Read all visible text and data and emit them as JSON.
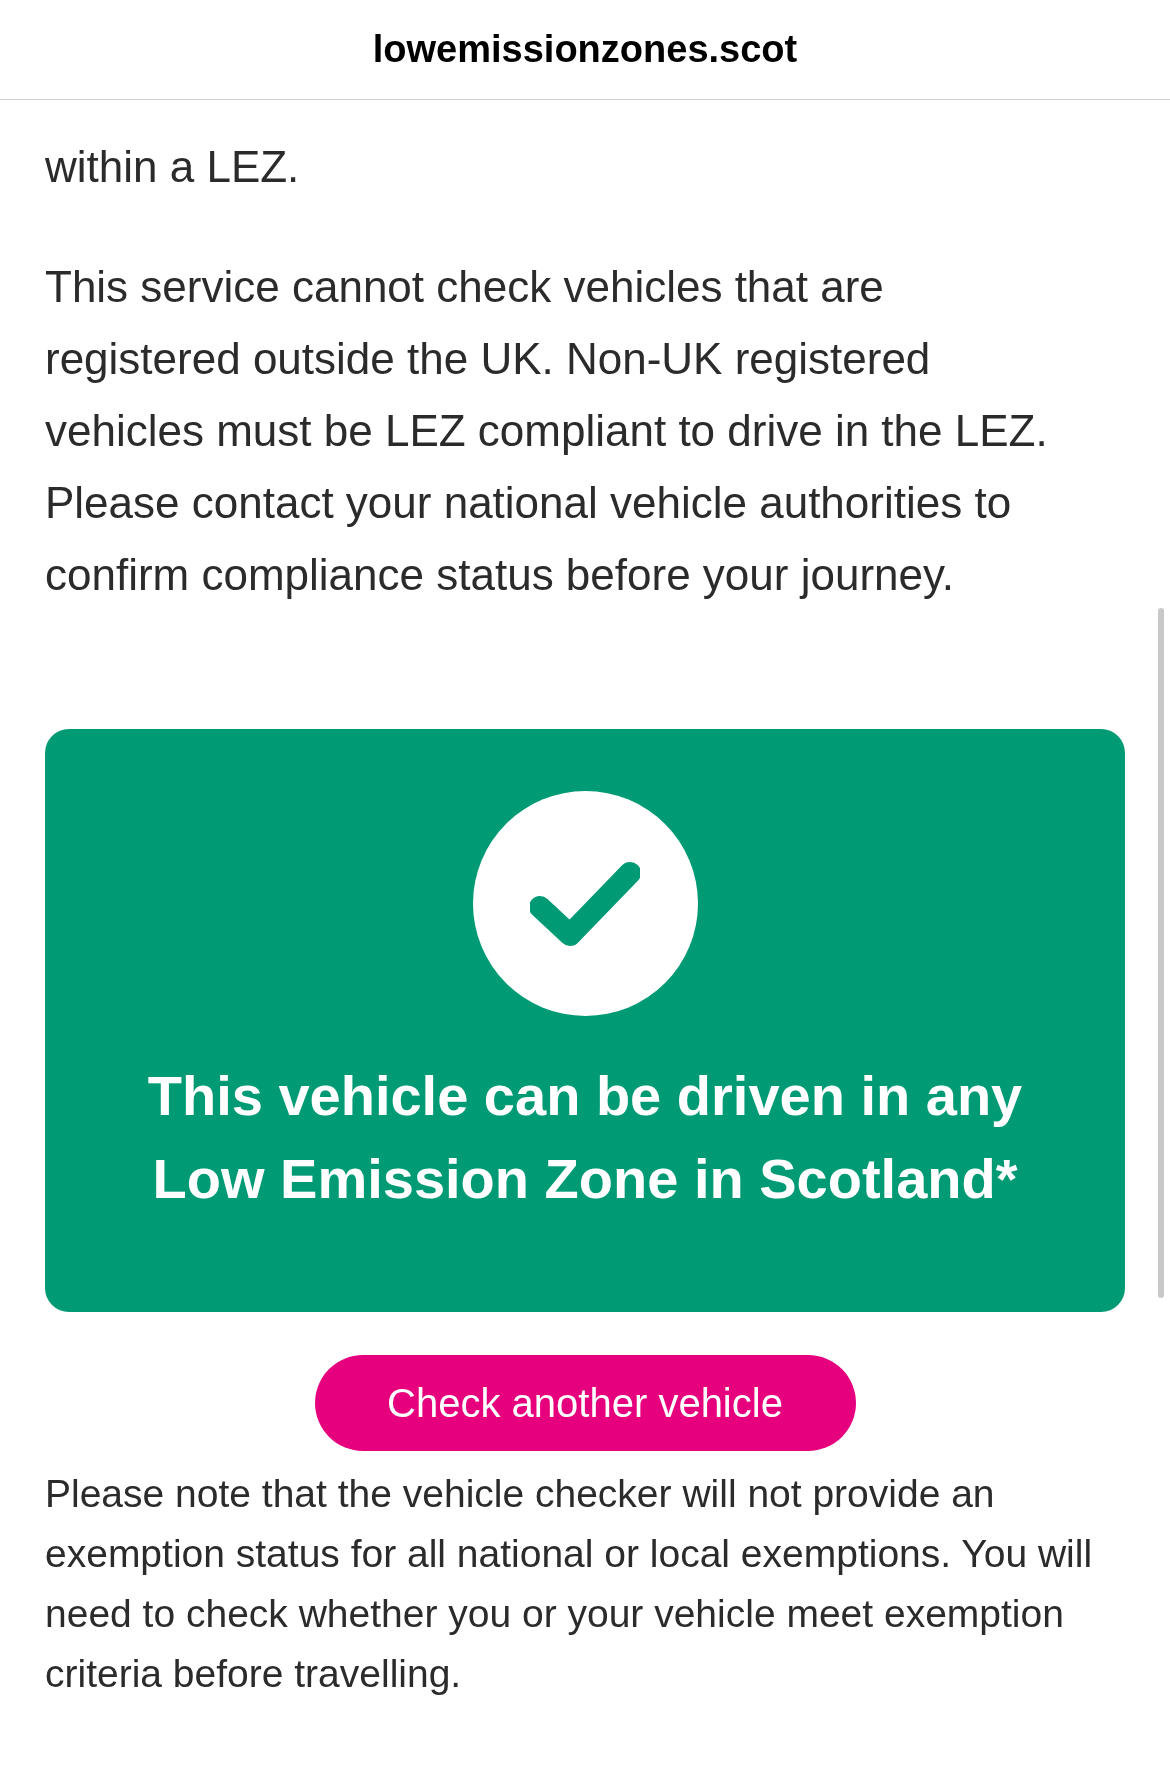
{
  "header": {
    "domain": "lowemissionzones.scot"
  },
  "intro": [
    "within a LEZ.",
    "This service cannot check vehicles that are registered outside the UK. Non-UK registered vehicles must be LEZ compliant to drive in the LEZ. Please contact your national vehicle authorities to confirm compliance status before your journey."
  ],
  "result": {
    "kind": "success",
    "message": "This vehicle can be driven in any Low Emission Zone in Scotland*"
  },
  "action_button": "Check another vehicle",
  "note": "Please note that the vehicle checker will not provide an exemption status for all national or local exemptions. You will need to check whether you or your vehicle meet exemption criteria before travelling."
}
